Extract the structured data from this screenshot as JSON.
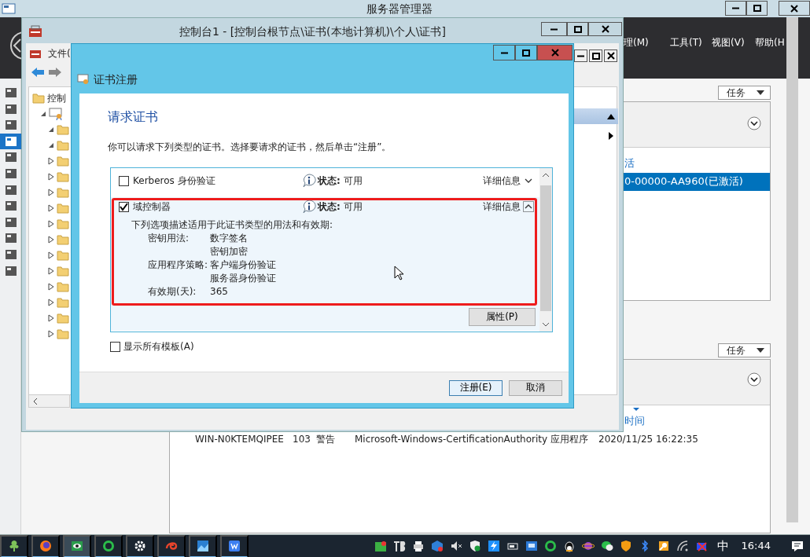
{
  "server_manager": {
    "title": "服务器管理器",
    "menus": [
      "理(M)",
      "工具(T)",
      "视图(V)",
      "帮助(H"
    ],
    "sidebar": [
      {
        "selected": false
      },
      {
        "selected": false
      },
      {
        "selected": false
      },
      {
        "selected": true
      },
      {
        "selected": false
      },
      {
        "selected": false
      },
      {
        "selected": false
      },
      {
        "selected": false
      },
      {
        "selected": false
      },
      {
        "selected": false
      },
      {
        "selected": false
      },
      {
        "selected": false
      }
    ],
    "top_panel": {
      "tasks": "任务",
      "column_header": "活",
      "rows": [
        {
          "text": "0-00000-AA960(已激活)",
          "selected": true
        }
      ]
    },
    "bottom_panel": {
      "tasks": "任务",
      "column_header": "时间",
      "rows": [
        {
          "cells": [
            "WIN-N0KTEMQIPEE",
            "103",
            "警告",
            "Microsoft-Windows-CertificationAuthority",
            "应用程序",
            "2020/11/25 16:22:35"
          ]
        }
      ]
    }
  },
  "console": {
    "title": "控制台1 - [控制台根节点\\证书(本地计算机)\\个人\\证书]",
    "menu": "文件(",
    "tree": [
      {
        "label": "控制",
        "children": [
          {
            "expanded": true,
            "children": [
              {
                "expanded": true
              },
              {
                "expanded": true
              },
              {
                "expanded": false
              },
              {
                "expanded": false
              },
              {
                "expanded": false
              },
              {
                "expanded": false
              },
              {
                "expanded": false
              },
              {
                "expanded": false
              },
              {
                "expanded": false
              },
              {
                "expanded": false
              },
              {
                "expanded": false
              },
              {
                "expanded": false
              },
              {
                "expanded": false
              },
              {
                "expanded": false
              }
            ]
          }
        ]
      }
    ]
  },
  "dialog": {
    "title": "证书注册",
    "heading": "请求证书",
    "description": "你可以请求下列类型的证书。选择要请求的证书，然后单击“注册”。",
    "templates": [
      {
        "name": "Kerberos 身份验证",
        "checked": false,
        "status_label": "状态:",
        "status": "可用",
        "details": "详细信息",
        "expanded": false
      },
      {
        "name": "域控制器",
        "checked": true,
        "status_label": "状态:",
        "status": "可用",
        "details": "详细信息",
        "expanded": true,
        "intro": "下列选项描述适用于此证书类型的用法和有效期:",
        "fields": [
          {
            "label": "密钥用法:",
            "values": [
              "数字签名",
              "密钥加密"
            ]
          },
          {
            "label": "应用程序策略:",
            "values": [
              "客户端身份验证",
              "服务器身份验证"
            ]
          },
          {
            "label": "有效期(天):",
            "values": [
              "365"
            ]
          }
        ],
        "properties_button": "属性(P)"
      }
    ],
    "show_all": {
      "label": "显示所有模板(A)",
      "checked": false
    },
    "buttons": [
      {
        "label": "注册(E)",
        "default": true
      },
      {
        "label": "取消",
        "default": false
      }
    ]
  },
  "taskbar": {
    "apps": [
      {
        "active": false
      },
      {
        "active": false
      },
      {
        "active": true
      },
      {
        "active": false
      },
      {
        "active": false
      },
      {
        "active": false
      },
      {
        "active": false
      },
      {
        "active": false
      }
    ],
    "ime": "中",
    "clock": "16:44"
  }
}
